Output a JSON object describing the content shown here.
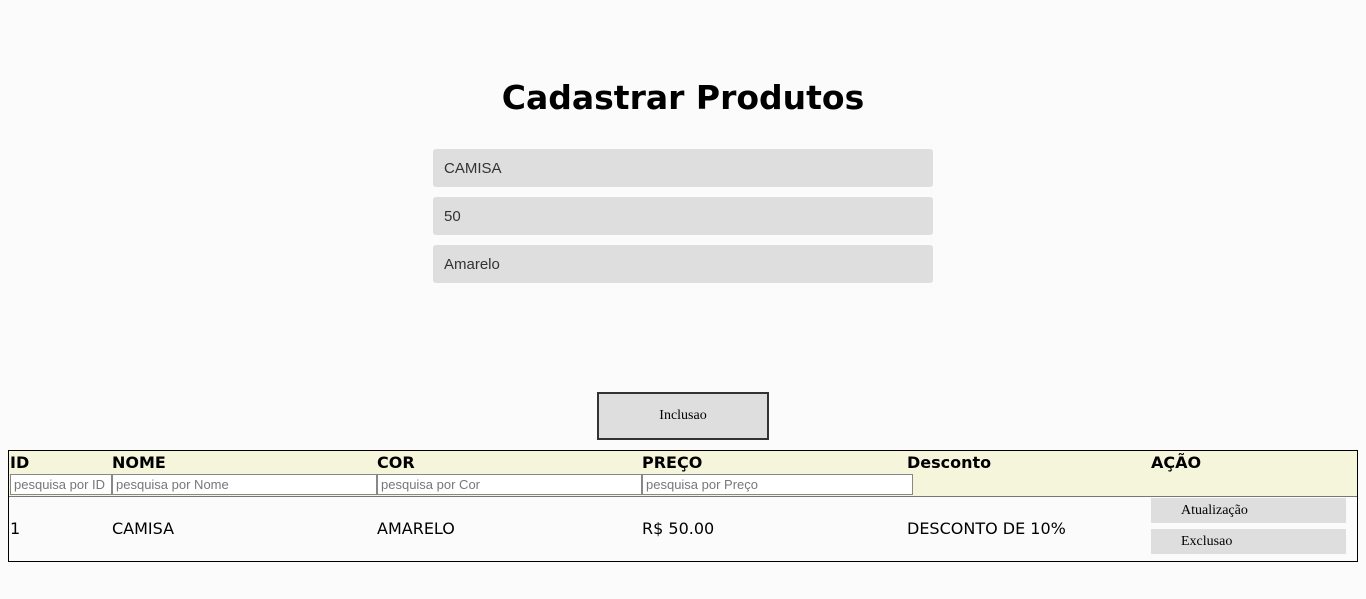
{
  "title": "Cadastrar Produtos",
  "form": {
    "nome_value": "CAMISA",
    "preco_value": "50",
    "cor_value": "Amarelo",
    "submit_label": "Inclusao"
  },
  "table": {
    "headers": [
      "ID",
      "NOME",
      "COR",
      "PREÇO",
      "Desconto",
      "AÇÃO"
    ],
    "search_placeholders": {
      "id": "pesquisa por ID",
      "nome": "pesquisa por Nome",
      "cor": "pesquisa por Cor",
      "preco": "pesquisa por Preço"
    },
    "rows": [
      {
        "id": "1",
        "nome": "CAMISA",
        "cor": "AMARELO",
        "preco": "R$ 50.00",
        "desconto": "DESCONTO DE 10%",
        "actions": [
          "Atualização",
          "Exclusao"
        ]
      }
    ]
  },
  "colors": {
    "header_bg": "#f5f5dc",
    "field_bg": "#dedede",
    "page_bg": "#fbfbfb"
  }
}
